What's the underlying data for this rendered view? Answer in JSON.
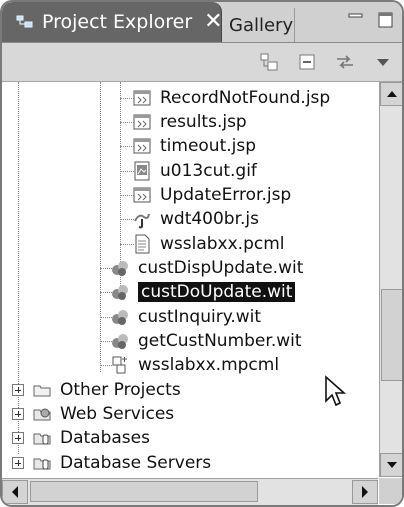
{
  "tabs": {
    "active_label": "Project Explorer",
    "active_icon": "project-explorer-icon",
    "close_glyph": "✕",
    "gallery_label": "Gallery"
  },
  "tree": {
    "items": [
      {
        "label": "RecordNotFound.jsp",
        "icon": "jsp-file-icon"
      },
      {
        "label": "results.jsp",
        "icon": "jsp-file-icon"
      },
      {
        "label": "timeout.jsp",
        "icon": "jsp-file-icon"
      },
      {
        "label": "u013cut.gif",
        "icon": "image-file-icon"
      },
      {
        "label": "UpdateError.jsp",
        "icon": "jsp-file-icon"
      },
      {
        "label": "wdt400br.js",
        "icon": "javascript-file-icon"
      },
      {
        "label": "wsslabxx.pcml",
        "icon": "document-file-icon"
      },
      {
        "label": "custDispUpdate.wit",
        "icon": "web-interaction-icon"
      },
      {
        "label": "custDoUpdate.wit",
        "icon": "web-interaction-icon",
        "selected": true
      },
      {
        "label": "custInquiry.wit",
        "icon": "web-interaction-icon"
      },
      {
        "label": "getCustNumber.wit",
        "icon": "web-interaction-icon"
      },
      {
        "label": "wsslabxx.mpcml",
        "icon": "mpcml-file-icon"
      },
      {
        "label": "Other Projects",
        "icon": "folder-icon",
        "expand": "+"
      },
      {
        "label": "Web Services",
        "icon": "web-services-folder-icon",
        "expand": "+"
      },
      {
        "label": "Databases",
        "icon": "database-folder-icon",
        "expand": "+"
      },
      {
        "label": "Database Servers",
        "icon": "database-folder-icon",
        "expand": "+"
      }
    ]
  },
  "scroll": {
    "vertical_position": 0.72,
    "horizontal_position": 0.0
  },
  "colors": {
    "active_tab": "#666666",
    "selection": "#111111",
    "panel_border": "#7a7a7a"
  }
}
